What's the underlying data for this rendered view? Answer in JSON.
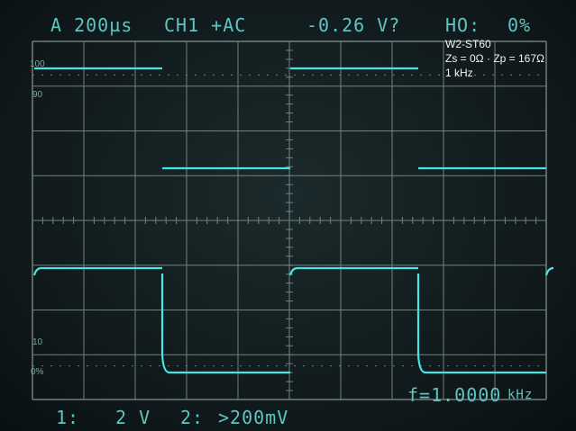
{
  "readout": {
    "timebase": "A 200µs",
    "channel": "CH1 +AC",
    "voltage": "-0.26 V?",
    "holdoff_label": "HO:",
    "holdoff_value": "0%",
    "ch1_label": "1:",
    "ch1_scale": "2 V",
    "ch2_label": "2:",
    "ch2_scale": ">200mV",
    "frequency": "f=1.0000",
    "frequency_unit": "kHz"
  },
  "annotation": {
    "model": "W2-ST60",
    "impedance": "Zs = 0Ω · Zp = 167Ω",
    "test_frequency": "1 kHz"
  },
  "graticule_labels": {
    "p100": "100",
    "p90": "90",
    "p10": "10",
    "p0": "0%"
  },
  "colors": {
    "trace": "#46e6e6",
    "graticule": "#8fa3a0",
    "readout": "#5fc4c4"
  },
  "traces": [
    {
      "name": "ch1-square-wave-upper",
      "levels": [
        "high",
        "low",
        "high",
        "low"
      ]
    },
    {
      "name": "ch2-square-wave-lower",
      "levels": [
        "high",
        "low",
        "high",
        "low",
        "high"
      ]
    }
  ]
}
